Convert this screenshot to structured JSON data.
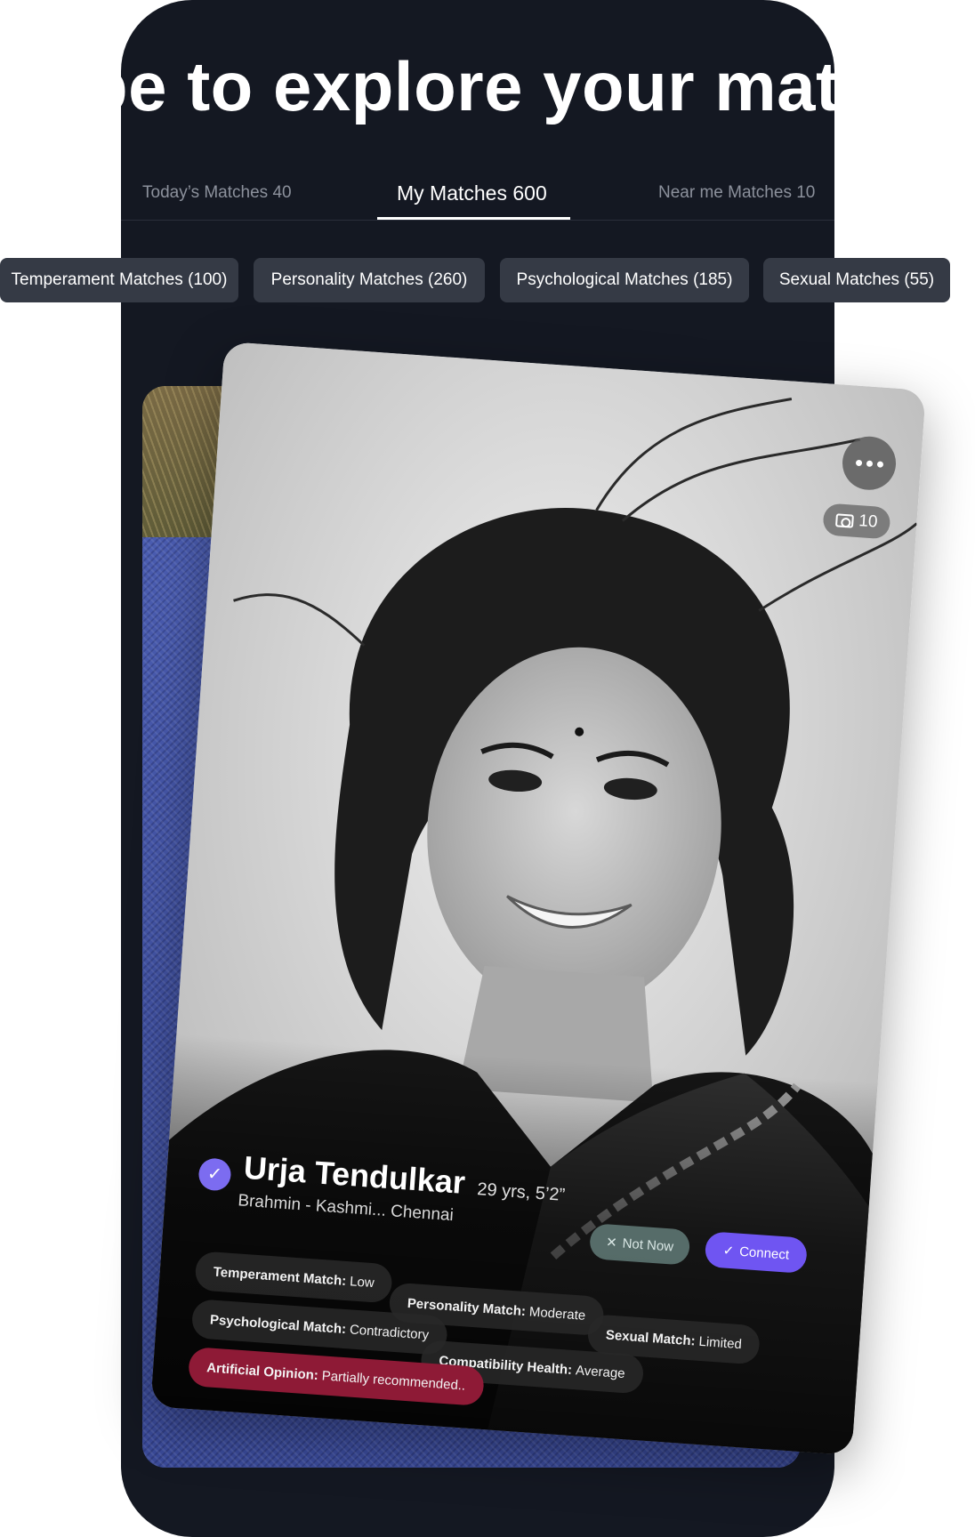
{
  "headline": "pe to explore your matc",
  "tabs": [
    {
      "label": "Today’s Matches 40"
    },
    {
      "label": "My Matches 600"
    },
    {
      "label": "Near me Matches 10"
    }
  ],
  "filters": [
    "Temperament Matches (100)",
    "Personality Matches (260)",
    "Psychological Matches (185)",
    "Sexual Matches (55)"
  ],
  "profile": {
    "name": "Urja Tendulkar",
    "age_height": "29 yrs, 5’2”",
    "location": "Brahmin - Kashmi... Chennai",
    "photo_count": "10",
    "not_now": "Not Now",
    "connect": "Connect",
    "attributes": {
      "temperament_label": "Temperament Match:",
      "temperament_value": "Low",
      "personality_label": "Personality Match:",
      "personality_value": "Moderate",
      "sexual_label": "Sexual Match:",
      "sexual_value": "Limited",
      "psychological_label": "Psychological Match:",
      "psychological_value": "Contradictory",
      "health_label": "Compatibility Health:",
      "health_value": "Average",
      "opinion_label": "Artificial Opinion:",
      "opinion_value": "Partially recommended.."
    }
  },
  "colors": {
    "background": "#141822",
    "accent": "#6f55f2",
    "verified": "#7c6cf0",
    "opinion": "#8e1a36"
  }
}
